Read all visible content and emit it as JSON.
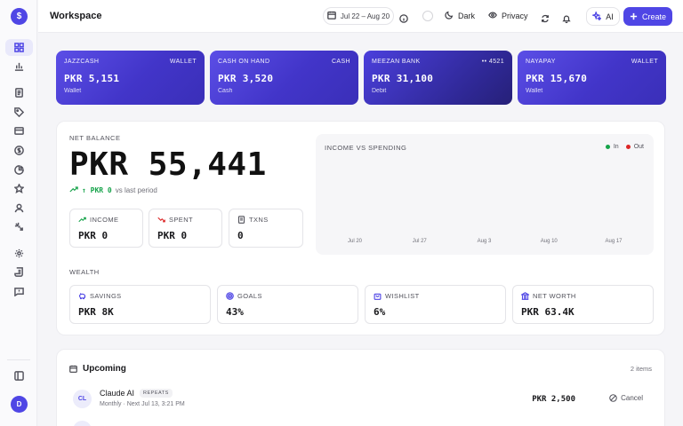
{
  "header": {
    "title": "Workspace",
    "date_range": "Jul 22 – Aug 20",
    "theme_label": "Dark",
    "privacy_label": "Privacy",
    "ai_label": "AI",
    "create_label": "Create"
  },
  "sidebar": {
    "avatar_initial": "D",
    "items": [
      "dashboard",
      "analytics",
      "reports",
      "tags",
      "archive",
      "currency",
      "pie",
      "favorites",
      "profile",
      "integrations",
      "settings",
      "receipts",
      "feedback"
    ]
  },
  "accounts": [
    {
      "name": "JAZZCASH",
      "type": "WALLET",
      "amount": "PKR 5,151",
      "sub": "Wallet"
    },
    {
      "name": "CASH ON HAND",
      "type": "CASH",
      "amount": "PKR 3,520",
      "sub": "Cash"
    },
    {
      "name": "MEEZAN BANK",
      "type": "•• 4521",
      "amount": "PKR 31,100",
      "sub": "Debit"
    },
    {
      "name": "NAYAPAY",
      "type": "WALLET",
      "amount": "PKR 15,670",
      "sub": "Wallet"
    }
  ],
  "net": {
    "label": "NET BALANCE",
    "amount": "PKR 55,441",
    "trend_value": "↑ PKR 0",
    "trend_suffix": "vs last period"
  },
  "stats": [
    {
      "label": "INCOME",
      "value": "PKR 0"
    },
    {
      "label": "SPENT",
      "value": "PKR 0"
    },
    {
      "label": "TXNS",
      "value": "0"
    }
  ],
  "chart_data": {
    "type": "area",
    "title": "INCOME VS SPENDING",
    "categories": [
      "Jul 20",
      "Jul 27",
      "Aug 3",
      "Aug 10",
      "Aug 17"
    ],
    "series": [
      {
        "name": "In",
        "values": [
          0,
          0,
          0,
          0,
          0
        ],
        "color": "#16a34a"
      },
      {
        "name": "Out",
        "values": [
          0,
          0,
          0,
          0,
          0
        ],
        "color": "#dc2626"
      }
    ],
    "legend": "top-right",
    "grid": false
  },
  "wealth": {
    "label": "WEALTH",
    "items": [
      {
        "label": "SAVINGS",
        "value": "PKR 8K"
      },
      {
        "label": "GOALS",
        "value": "43%"
      },
      {
        "label": "WISHLIST",
        "value": "6%"
      },
      {
        "label": "NET WORTH",
        "value": "PKR 63.4K"
      }
    ]
  },
  "upcoming": {
    "title": "Upcoming",
    "count": "2 items",
    "items": [
      {
        "initials": "CL",
        "name": "Claude AI",
        "badge": "REPEATS",
        "meta": "Monthly · Next Jul 13, 3:21 PM",
        "amount": "PKR 2,500",
        "action": "Cancel"
      }
    ]
  },
  "colors": {
    "accent": "#4f46e5",
    "positive": "#16a34a",
    "negative": "#dc2626"
  }
}
